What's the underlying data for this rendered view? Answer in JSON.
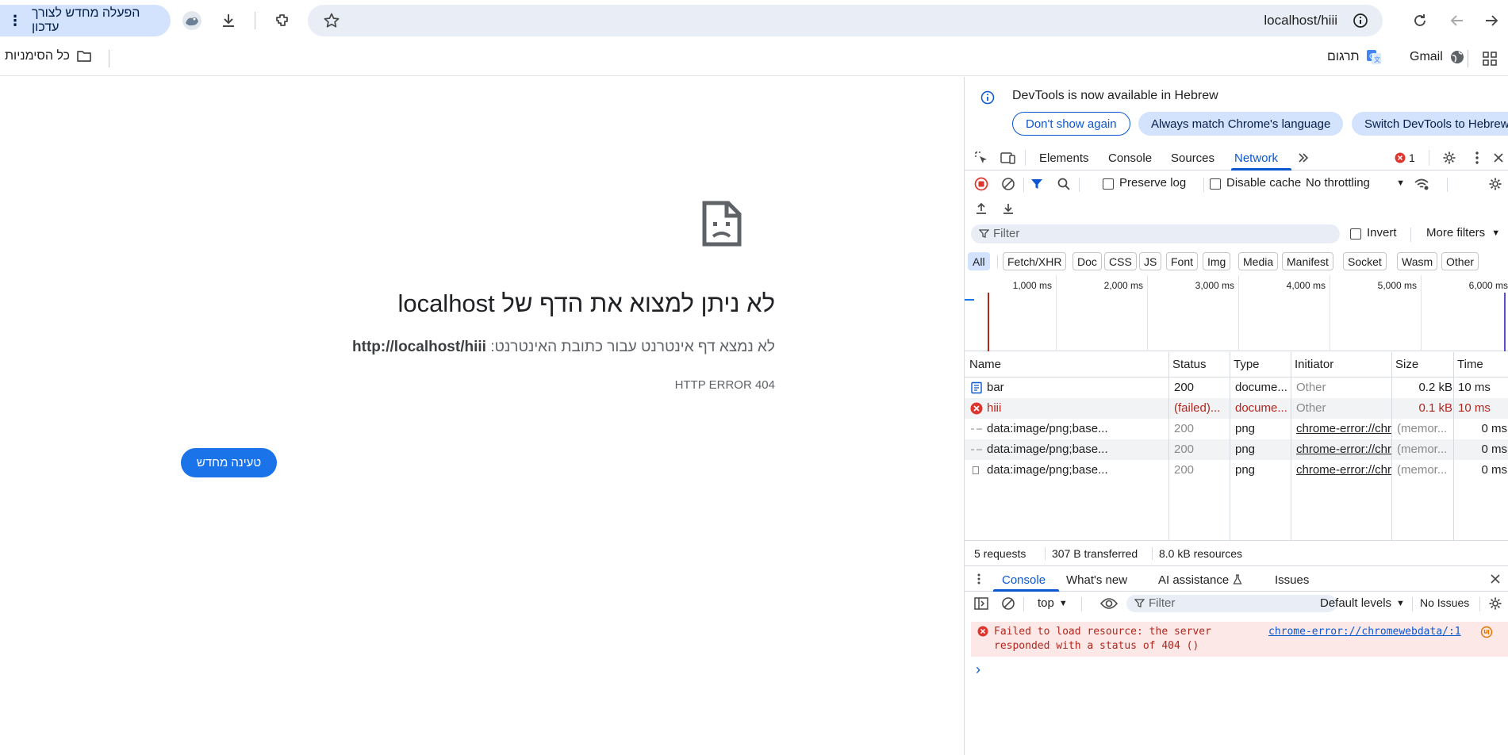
{
  "toolbar": {
    "update_label": "הפעלה מחדש לצורך עדכון",
    "url": "localhost/hiii"
  },
  "bookmarks": {
    "all_bookmarks": "כל הסימניות",
    "translate": "תרגום",
    "gmail": "Gmail"
  },
  "error_page": {
    "title": "לא ניתן למצוא את הדף של localhost",
    "desc_prefix": "לא נמצא דף אינטרנט עבור כתובת האינטרנט: ",
    "desc_url": "http://localhost/hiii",
    "code": "HTTP ERROR 404",
    "reload_label": "טעינה מחדש"
  },
  "devtools": {
    "notice": {
      "text": "DevTools is now available in Hebrew",
      "dont_show": "Don't show again",
      "always_match": "Always match Chrome's language",
      "switch": "Switch DevTools to Hebrew"
    },
    "tabs": [
      "Elements",
      "Console",
      "Sources",
      "Network"
    ],
    "error_count": "1",
    "network_toolbar": {
      "preserve_log": "Preserve log",
      "disable_cache": "Disable cache",
      "throttling": "No throttling"
    },
    "filter_placeholder": "Filter",
    "invert": "Invert",
    "more_filters": "More filters",
    "chips": [
      "All",
      "Fetch/XHR",
      "Doc",
      "CSS",
      "JS",
      "Font",
      "Img",
      "Media",
      "Manifest",
      "Socket",
      "Wasm",
      "Other"
    ],
    "timeline_labels": [
      "1,000 ms",
      "2,000 ms",
      "3,000 ms",
      "4,000 ms",
      "5,000 ms",
      "6,000 ms"
    ],
    "columns": [
      "Name",
      "Status",
      "Type",
      "Initiator",
      "Size",
      "Time"
    ],
    "rows": [
      {
        "name": "bar",
        "status": "200",
        "type": "docume...",
        "initiator": "Other",
        "size": "0.2 kB",
        "time": "10 ms"
      },
      {
        "name": "hiii",
        "status": "(failed)...",
        "type": "docume...",
        "initiator": "Other",
        "size": "0.1 kB",
        "time": "10 ms"
      },
      {
        "name": "data:image/png;base...",
        "status": "200",
        "type": "png",
        "initiator": "chrome-error://chromewebdata",
        "size": "(memor...",
        "time": "0 ms"
      },
      {
        "name": "data:image/png;base...",
        "status": "200",
        "type": "png",
        "initiator": "chrome-error://chromewebdata",
        "size": "(memor...",
        "time": "0 ms"
      },
      {
        "name": "data:image/png;base...",
        "status": "200",
        "type": "png",
        "initiator": "chrome-error://chromewebdata",
        "size": "(memor...",
        "time": "0 ms"
      }
    ],
    "summary": {
      "requests": "5 requests",
      "transferred": "307 B transferred",
      "resources": "8.0 kB resources"
    },
    "drawer": {
      "tabs": [
        "Console",
        "What's new",
        "AI assistance",
        "Issues"
      ],
      "context": "top",
      "filter_placeholder": "Filter",
      "levels": "Default levels",
      "issues": "No Issues",
      "error_message_line1": "Failed to load resource: the server",
      "error_message_line2": "responded with a status of 404 ()",
      "error_source": "chrome-error://chromewebdata/:1",
      "prompt": "›"
    }
  }
}
